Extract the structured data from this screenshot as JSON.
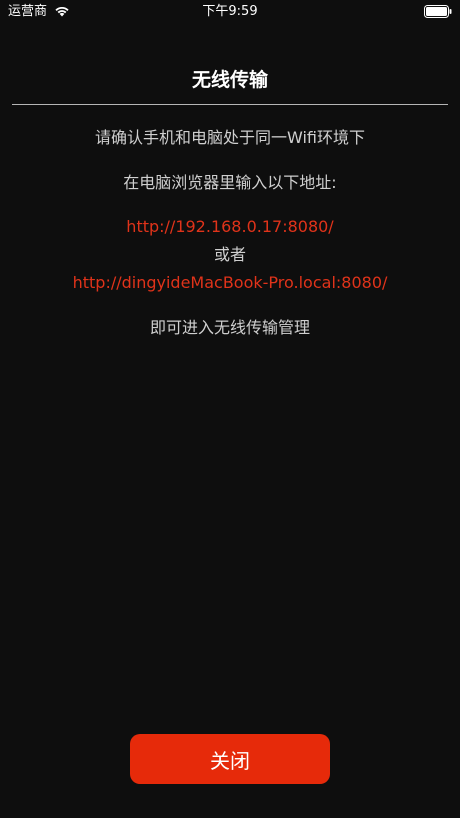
{
  "status_bar": {
    "carrier": "运营商",
    "time": "下午9:59",
    "wifi_icon": "wifi-icon",
    "battery_icon": "battery-icon"
  },
  "header": {
    "title": "无线传输"
  },
  "content": {
    "instruction_same_wifi": "请确认手机和电脑处于同一Wifi环境下",
    "instruction_enter_address": "在电脑浏览器里输入以下地址:",
    "address_ip": "http://192.168.0.17:8080/",
    "or_text": "或者",
    "address_host": "http://dingyideMacBook-Pro.local:8080/",
    "instruction_manage": "即可进入无线传输管理"
  },
  "actions": {
    "close_label": "关闭"
  },
  "colors": {
    "background": "#0e0e0e",
    "link": "#e0331a",
    "button": "#e62a0a"
  }
}
